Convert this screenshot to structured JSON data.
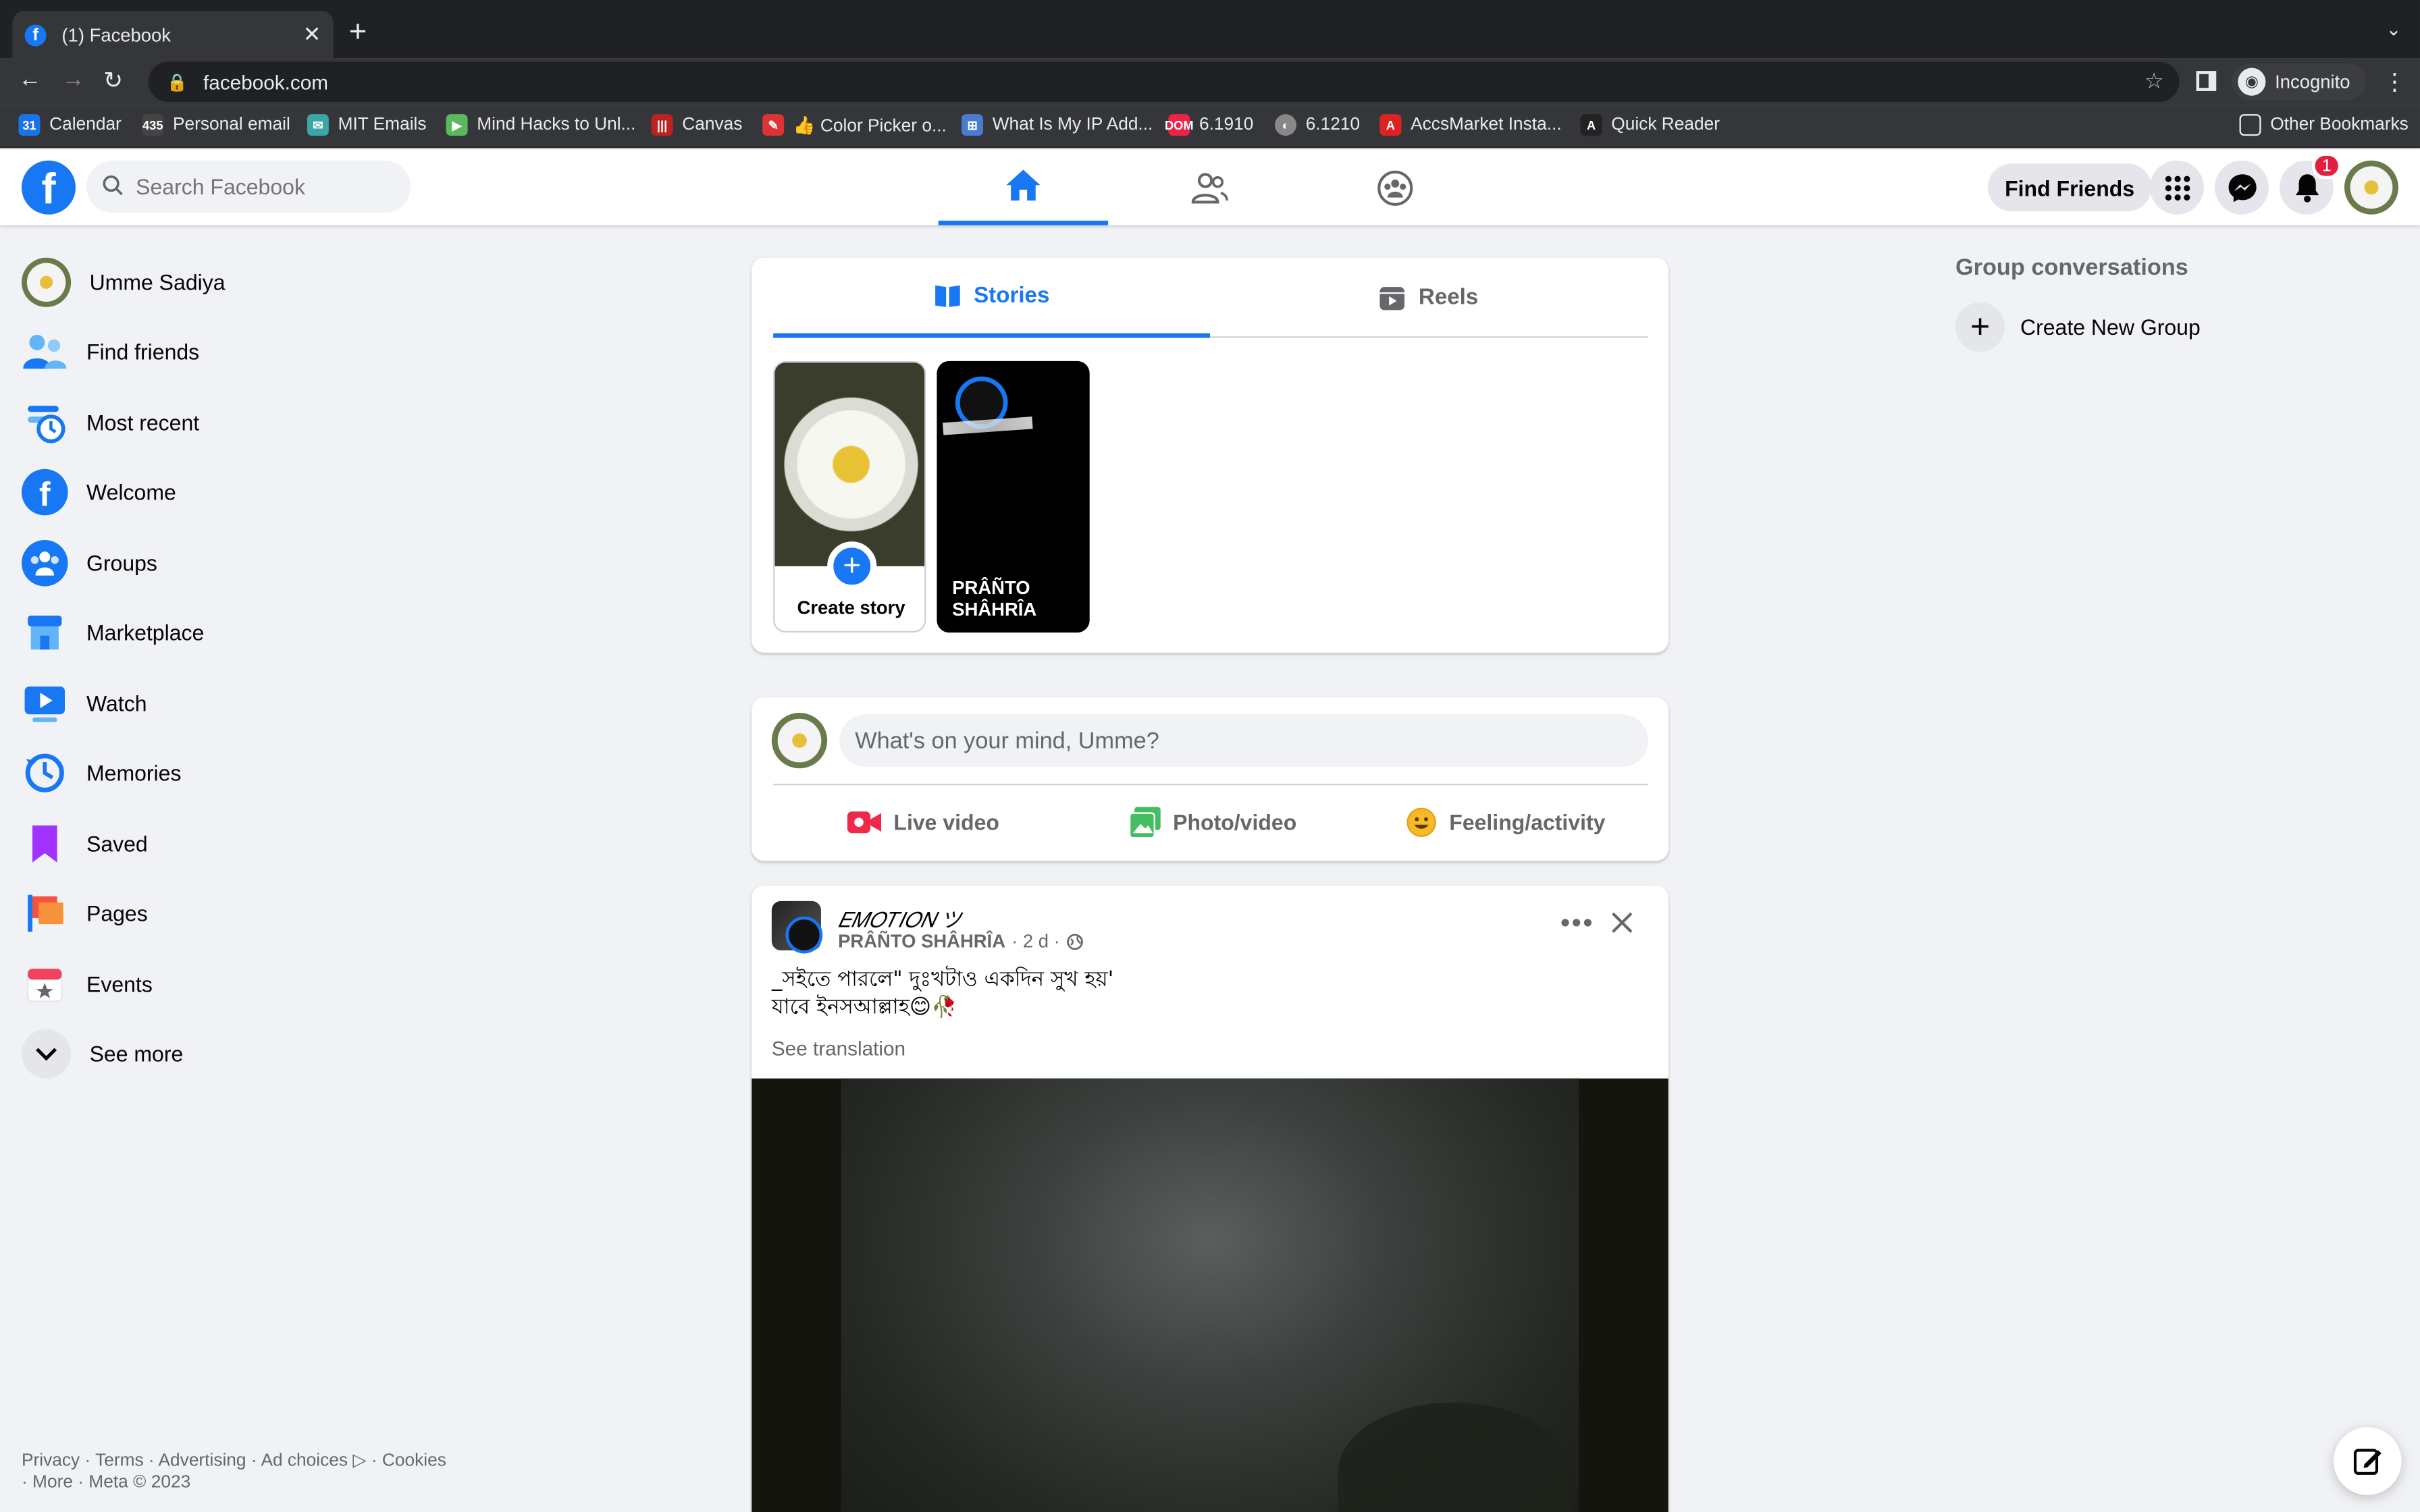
{
  "browser": {
    "tab_title": "(1) Facebook",
    "url": "facebook.com",
    "profile_label": "Incognito",
    "bookmarks": [
      "Calendar",
      "Personal email",
      "MIT Emails",
      "Mind Hacks to Unl...",
      "Canvas",
      "👍 Color Picker o...",
      "What Is My IP Add...",
      "6.1910",
      "6.1210",
      "AccsMarket Insta...",
      "Quick Reader"
    ],
    "other_bookmarks": "Other Bookmarks"
  },
  "header": {
    "search_placeholder": "Search Facebook",
    "find_friends": "Find Friends",
    "notification_count": "1",
    "accent": "#1877f2"
  },
  "sidebar": {
    "profile_name": "Umme Sadiya",
    "items": [
      {
        "label": "Find friends"
      },
      {
        "label": "Most recent"
      },
      {
        "label": "Welcome"
      },
      {
        "label": "Groups"
      },
      {
        "label": "Marketplace"
      },
      {
        "label": "Watch"
      },
      {
        "label": "Memories"
      },
      {
        "label": "Saved"
      },
      {
        "label": "Pages"
      },
      {
        "label": "Events"
      },
      {
        "label": "See more"
      }
    ],
    "footer_line1": "Privacy · Terms · Advertising · Ad choices ▷ · Cookies",
    "footer_line2": "· More · Meta © 2023"
  },
  "stories": {
    "tab_stories": "Stories",
    "tab_reels": "Reels",
    "create_story": "Create story",
    "story_user": "PRÂÑTO SHÂHRÎA"
  },
  "composer": {
    "placeholder": "What's on your mind, Umme?",
    "live_video": "Live video",
    "photo_video": "Photo/video",
    "feeling": "Feeling/activity"
  },
  "post": {
    "group_name": "𝐸𝑀𝑂𝑇𝐼𝑂𝑁 ツ",
    "author": "PRÂÑTO SHÂHRÎA",
    "time": "· 2 d ·",
    "text_line1": "_সইতে পারলে\" দুঃখটাও একদিন সুখ হয়'",
    "text_line2": "যাবে ইনসআল্লাহ😊🥀",
    "see_translation": "See translation"
  },
  "right": {
    "group_conversations": "Group conversations",
    "create_group": "Create New Group"
  }
}
